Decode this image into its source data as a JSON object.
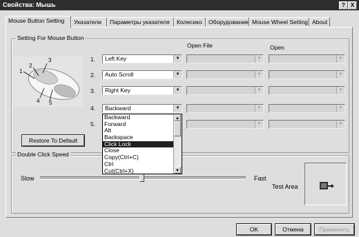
{
  "window": {
    "title": "Свойства: Мышь",
    "help_btn": "?",
    "close_btn": "X"
  },
  "tabs": [
    "Mouse Button Setting",
    "Указатели",
    "Параметры указателя",
    "Колесико",
    "Оборудование",
    "Mouse Wheel Setting",
    "About"
  ],
  "button_group": {
    "legend": "Setting For Mouse Button",
    "callouts": [
      "1",
      "2",
      "3",
      "4",
      "5"
    ],
    "open_file_header": "Open File",
    "open_header": "Open",
    "rows": [
      {
        "num": "1.",
        "value": "Left Key"
      },
      {
        "num": "2.",
        "value": "Auto Scroll"
      },
      {
        "num": "3.",
        "value": "Right Key"
      },
      {
        "num": "4.",
        "value": "Backward"
      },
      {
        "num": "5.",
        "value": ""
      }
    ],
    "restore_btn": "Restore To Default"
  },
  "dropdown": {
    "items": [
      "Backward",
      "Forward",
      "Alt",
      "Backspace",
      "Click Lock",
      "Close",
      "Copy(Ctrl+C)",
      "Ctrl",
      "Cut(Ctrl+X)"
    ],
    "selected_index": 4
  },
  "dblclick_group": {
    "legend": "Double Click Speed",
    "slow": "Slow",
    "fast": "Fast",
    "test_area": "Test Area",
    "speed_level": 0.5
  },
  "footer": {
    "ok": "OK",
    "cancel": "Отмена",
    "apply": "Применить"
  },
  "colors": {
    "title_bg": "#2e2e2e",
    "selection": "#1e1e1e"
  }
}
